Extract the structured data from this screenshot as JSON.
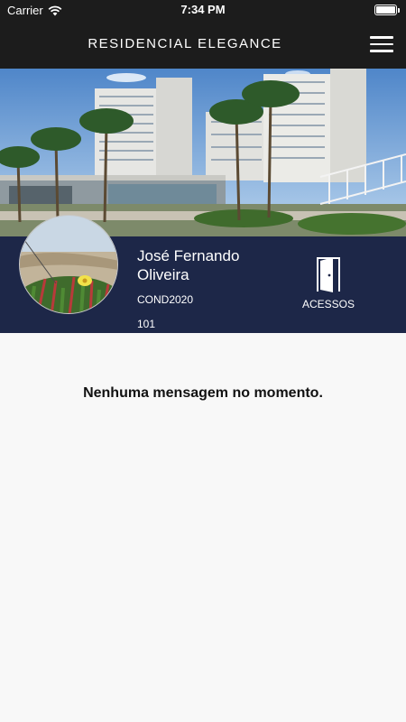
{
  "status": {
    "carrier": "Carrier",
    "time": "7:34 PM",
    "battery_level": 1.0
  },
  "header": {
    "title": "RESIDENCIAL ELEGANCE",
    "menu_icon": "hamburger-icon"
  },
  "profile": {
    "name": "José Fernando Oliveira",
    "code": "COND2020",
    "unit": "101",
    "access_label": "ACESSOS",
    "access_icon": "door-icon",
    "background_color": "#1d2748"
  },
  "messages": {
    "empty_text": "Nenhuma mensagem no momento."
  }
}
